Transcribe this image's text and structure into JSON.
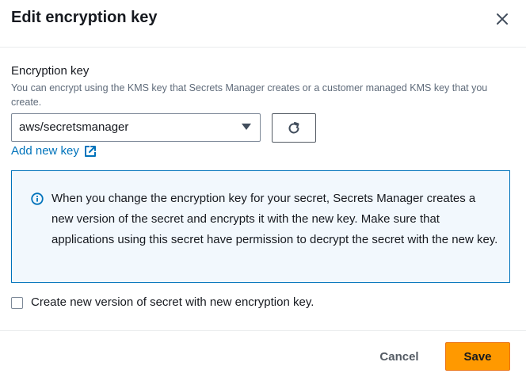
{
  "modal": {
    "title": "Edit encryption key",
    "close_icon": "close-icon"
  },
  "encryption_key": {
    "label": "Encryption key",
    "description": "You can encrypt using the KMS key that Secrets Manager creates or a customer managed KMS key that you create.",
    "selected_value": "aws/secretsmanager",
    "refresh_icon": "refresh-icon",
    "add_new_key_label": "Add new key",
    "external_link_icon": "external-link-icon"
  },
  "alert": {
    "icon": "info-icon",
    "text": "When you change the encryption key for your secret, Secrets Manager creates a new version of the secret and encrypts it with the new key. Make sure that applications using this secret have permission to decrypt the secret with the new key."
  },
  "checkbox": {
    "label": "Create new version of secret with new encryption key.",
    "checked": false
  },
  "footer": {
    "cancel_label": "Cancel",
    "save_label": "Save"
  },
  "colors": {
    "primary_button": "#ff9900",
    "link": "#0073bb",
    "info_border": "#0073bb",
    "info_background": "#f2f8fd"
  }
}
